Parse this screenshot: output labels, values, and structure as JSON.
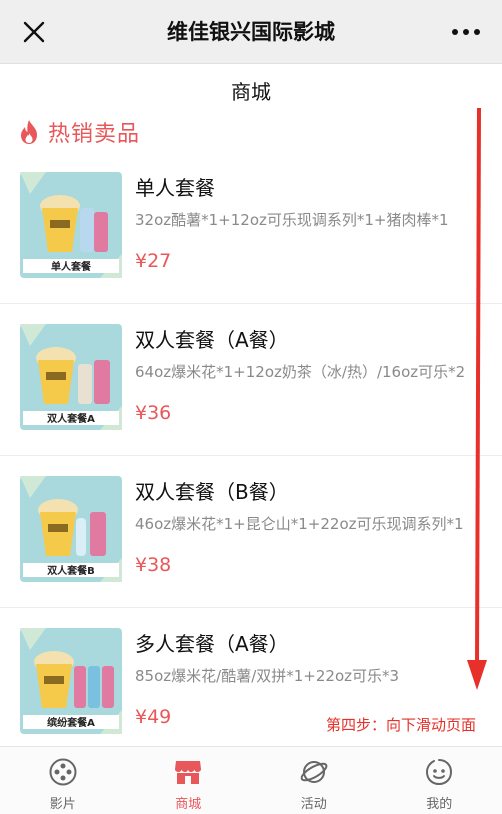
{
  "topbar": {
    "title": "维佳银兴国际影城"
  },
  "page": {
    "title": "商城"
  },
  "section": {
    "title": "热销卖品"
  },
  "products": [
    {
      "name": "单人套餐",
      "desc": "32oz酷薯*1+12oz可乐现调系列*1+猪肉棒*1",
      "price": "¥27",
      "badge": "单人套餐"
    },
    {
      "name": "双人套餐（A餐）",
      "desc": "64oz爆米花*1+12oz奶茶（冰/热）/16oz可乐*2",
      "price": "¥36",
      "badge": "双人套餐A"
    },
    {
      "name": "双人套餐（B餐）",
      "desc": "46oz爆米花*1+昆仑山*1+22oz可乐现调系列*1",
      "price": "¥38",
      "badge": "双人套餐B"
    },
    {
      "name": "多人套餐（A餐）",
      "desc": "85oz爆米花/酷薯/双拼*1+22oz可乐*3",
      "price": "¥49",
      "badge": "缤纷套餐A"
    }
  ],
  "annotation": {
    "text": "第四步：向下滑动页面"
  },
  "nav": [
    {
      "label": "影片",
      "icon": "film-reel-icon",
      "active": false
    },
    {
      "label": "商城",
      "icon": "shop-icon",
      "active": true
    },
    {
      "label": "活动",
      "icon": "planet-icon",
      "active": false
    },
    {
      "label": "我的",
      "icon": "profile-face-icon",
      "active": false
    }
  ],
  "colors": {
    "accent": "#e8575a",
    "annotation": "#e8302a"
  }
}
